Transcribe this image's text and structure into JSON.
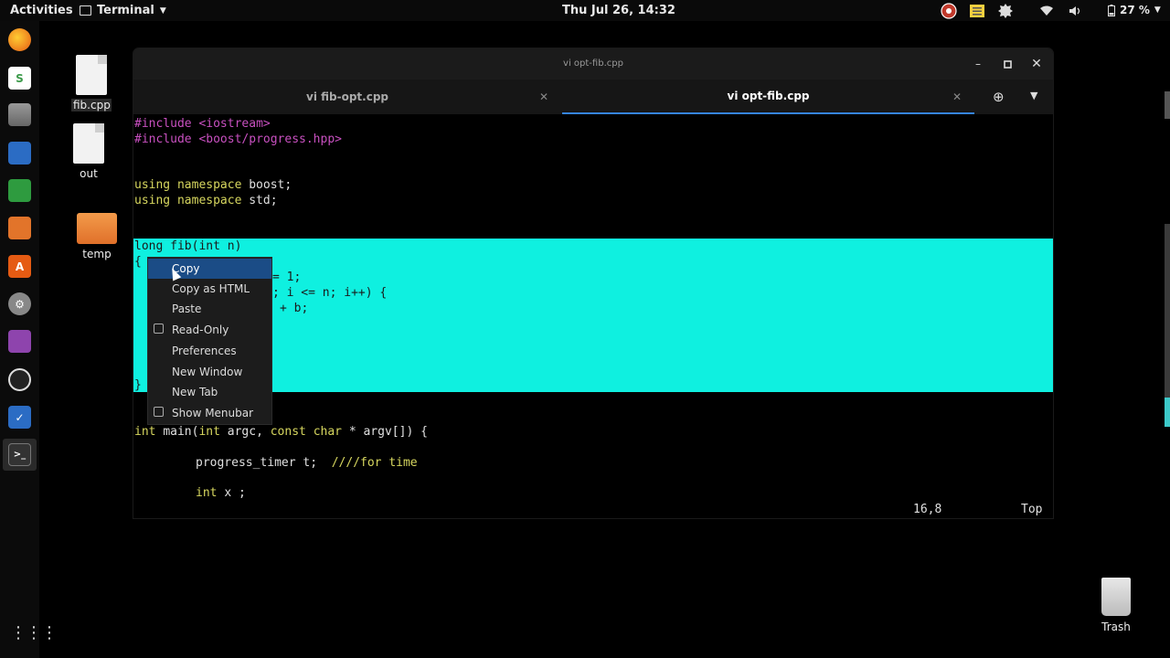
{
  "topbar": {
    "activities": "Activities",
    "app_menu": "Terminal",
    "clock": "Thu Jul 26, 14:32",
    "battery": "27 %",
    "tray_icons": [
      "obs-icon",
      "notes-icon",
      "puzzle-icon",
      "wifi-icon",
      "volume-icon",
      "battery-icon"
    ]
  },
  "dock": {
    "items": [
      "firefox-icon",
      "slack-icon",
      "files-icon",
      "writer-icon",
      "calc-icon",
      "impress-icon",
      "software-icon",
      "settings-icon",
      "screenshot-icon",
      "obs-icon",
      "tasks-icon",
      "terminal-icon"
    ],
    "apps_button": "show-apps-icon"
  },
  "desktop": {
    "icons": [
      {
        "label": "fib.cpp",
        "kind": "file"
      },
      {
        "label": "out",
        "kind": "file"
      },
      {
        "label": "temp",
        "kind": "folder"
      }
    ],
    "trash_label": "Trash"
  },
  "window": {
    "title": "vi opt-fib.cpp",
    "tabs": [
      {
        "label": "vi fib-opt.cpp",
        "active": false
      },
      {
        "label": "vi opt-fib.cpp",
        "active": true
      }
    ]
  },
  "terminal": {
    "lines": [
      {
        "parts": [
          {
            "t": "#include ",
            "c": "pp"
          },
          {
            "t": "<iostream>",
            "c": "pp"
          }
        ]
      },
      {
        "parts": [
          {
            "t": "#include ",
            "c": "pp"
          },
          {
            "t": "<boost/progress.hpp>",
            "c": "pp"
          }
        ]
      },
      {
        "parts": [
          {
            "t": "using namespace ",
            "c": "kw"
          },
          {
            "t": "boost;",
            "c": "id"
          }
        ]
      },
      {
        "parts": [
          {
            "t": "using namespace ",
            "c": "kw"
          },
          {
            "t": "std;",
            "c": "id"
          }
        ]
      },
      {
        "parts": [
          {
            "t": "long fib(int n)",
            "c": "blk"
          }
        ]
      },
      {
        "parts": [
          {
            "t": "{",
            "c": "blk"
          }
        ]
      },
      {
        "parts": [
          {
            "t": "= 1;",
            "c": "blk"
          }
        ]
      },
      {
        "parts": [
          {
            "t": "; i <= n; i++) {",
            "c": "blk"
          }
        ]
      },
      {
        "parts": [
          {
            "t": "+ b;",
            "c": "blk"
          }
        ]
      },
      {
        "parts": [
          {
            "t": "}",
            "c": "blk"
          }
        ]
      },
      {
        "parts": [
          {
            "t": "int ",
            "c": "kw"
          },
          {
            "t": "main(",
            "c": "id"
          },
          {
            "t": "int ",
            "c": "kw"
          },
          {
            "t": "argc, ",
            "c": "id"
          },
          {
            "t": "const char ",
            "c": "kw"
          },
          {
            "t": "* argv[]) {",
            "c": "id"
          }
        ]
      },
      {
        "parts": [
          {
            "t": "progress_timer t;  ",
            "c": "id"
          },
          {
            "t": "////for time",
            "c": "kw"
          }
        ]
      },
      {
        "parts": [
          {
            "t": "int ",
            "c": "kw"
          },
          {
            "t": "x ;",
            "c": "id"
          }
        ]
      }
    ],
    "status_pos": "16,8",
    "status_top": "Top"
  },
  "context_menu": {
    "items": [
      {
        "label": "Copy",
        "check": false,
        "highlight": true
      },
      {
        "label": "Copy as HTML",
        "check": false,
        "highlight": false
      },
      {
        "label": "Paste",
        "check": false,
        "highlight": false
      },
      {
        "label": "Read-Only",
        "check": true,
        "highlight": false
      },
      {
        "label": "Preferences",
        "check": false,
        "highlight": false
      },
      {
        "label": "New Window",
        "check": false,
        "highlight": false
      },
      {
        "label": "New Tab",
        "check": false,
        "highlight": false
      },
      {
        "label": "Show Menubar",
        "check": true,
        "highlight": false
      }
    ]
  },
  "colors": {
    "selection": "#0ff0e0",
    "preprocessor": "#c850c0",
    "keyword": "#d7d75f",
    "accent": "#3584e4"
  }
}
